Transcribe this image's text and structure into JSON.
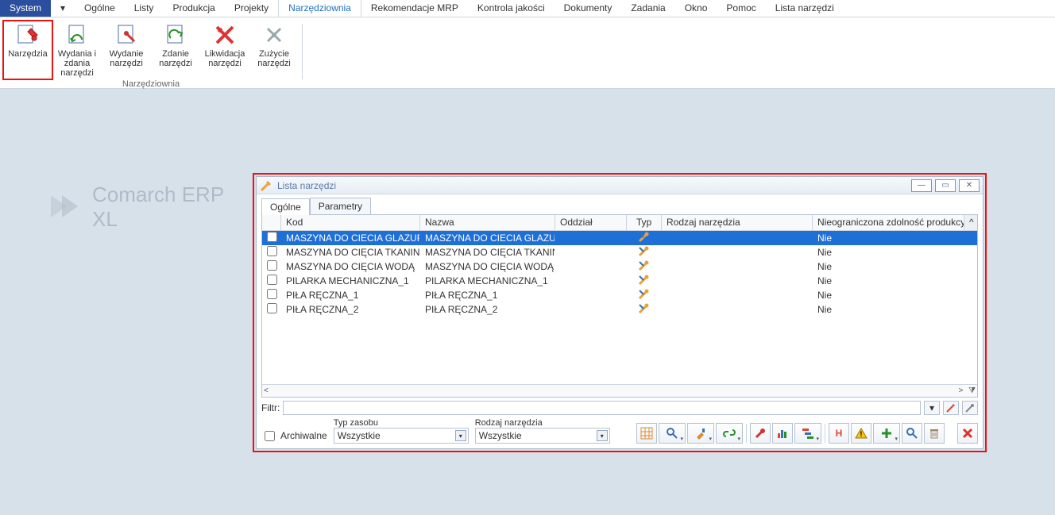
{
  "menubar": {
    "system": "System",
    "items": [
      "Ogólne",
      "Listy",
      "Produkcja",
      "Projekty",
      "Narzędziownia",
      "Rekomendacje MRP",
      "Kontrola jakości",
      "Dokumenty",
      "Zadania",
      "Okno",
      "Pomoc",
      "Lista narzędzi"
    ],
    "active_index": 4
  },
  "ribbon": {
    "group_label": "Narzędziownia",
    "buttons": [
      {
        "label": "Narzędzia"
      },
      {
        "label": "Wydania i zdania narzędzi"
      },
      {
        "label": "Wydanie narzędzi"
      },
      {
        "label": "Zdanie narzędzi"
      },
      {
        "label": "Likwidacja narzędzi"
      },
      {
        "label": "Zużycie narzędzi"
      }
    ]
  },
  "watermark": {
    "line1": "Comarch ERP",
    "line2": "XL"
  },
  "window": {
    "title": "Lista narzędzi",
    "tabs": [
      "Ogólne",
      "Parametry"
    ],
    "active_tab": 0,
    "columns": {
      "kod": "Kod",
      "nazwa": "Nazwa",
      "oddzial": "Oddział",
      "typ": "Typ",
      "rodzaj": "Rodzaj narzędzia",
      "nieograniczona": "Nieograniczona zdolność produkcyjna"
    },
    "rows": [
      {
        "kod": "MASZYNA DO CIECIA GLAZURY",
        "nazwa": "MASZYNA DO CIECIA GLAZURY",
        "oddzial": "",
        "rodzaj": "",
        "nie": "Nie"
      },
      {
        "kod": "MASZYNA DO CIĘCIA TKANIN",
        "nazwa": "MASZYNA DO CIĘCIA TKANIN",
        "oddzial": "",
        "rodzaj": "",
        "nie": "Nie"
      },
      {
        "kod": "MASZYNA DO CIĘCIA WODĄ",
        "nazwa": "MASZYNA DO CIĘCIA WODĄ",
        "oddzial": "",
        "rodzaj": "",
        "nie": "Nie"
      },
      {
        "kod": "PILARKA MECHANICZNA_1",
        "nazwa": "PILARKA MECHANICZNA_1",
        "oddzial": "",
        "rodzaj": "",
        "nie": "Nie"
      },
      {
        "kod": "PIŁA RĘCZNA_1",
        "nazwa": "PIŁA RĘCZNA_1",
        "oddzial": "",
        "rodzaj": "",
        "nie": "Nie"
      },
      {
        "kod": "PIŁA RĘCZNA_2",
        "nazwa": "PIŁA RĘCZNA_2",
        "oddzial": "",
        "rodzaj": "",
        "nie": "Nie"
      }
    ],
    "selected_row": 0,
    "filter_label": "Filtr:",
    "archiwalne_label": "Archiwalne",
    "typ_zasobu": {
      "label": "Typ zasobu",
      "value": "Wszystkie"
    },
    "rodzaj_narzedzia": {
      "label": "Rodzaj narzędzia",
      "value": "Wszystkie"
    }
  }
}
